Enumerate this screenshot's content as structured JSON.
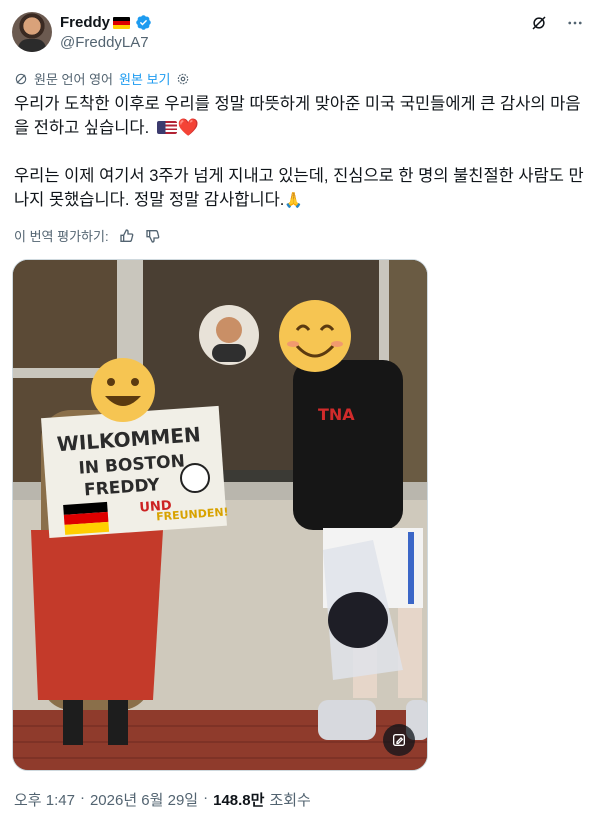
{
  "author": {
    "display_name": "Freddy",
    "handle": "@FreddyLA7",
    "avatar_icon": "profile-photo",
    "verified_icon": "verified-badge-icon"
  },
  "header_actions": {
    "grok_icon": "grok-icon",
    "more_icon": "more-options-icon"
  },
  "translation": {
    "label": "원문 언어 영어",
    "link": "원본 보기",
    "settings_icon": "gear-icon"
  },
  "tweet": {
    "paragraph1": "우리가 도착한 이후로 우리를 정말 따뜻하게 맞아준 미국 국민들에게 큰 감사의 마음을 전하고 싶습니다.",
    "paragraph2": "우리는 이제 여기서 3주가 넘게 지내고 있는데, 진심으로 한 명의 불친절한 사람도 만나지 못했습니다. 정말 정말 감사합니다.",
    "heart_emoji": "❤️",
    "pray_emoji": "🙏"
  },
  "rate_translation": {
    "label": "이 번역 평가하기:",
    "up_icon": "thumbs-up-icon",
    "down_icon": "thumbs-down-icon"
  },
  "photo": {
    "sign_lines": [
      "WILKOMMEN",
      "IN BOSTON",
      "FREDDY",
      "UND",
      "FREUNDEN!"
    ],
    "shirt_text": "TNA",
    "edit_icon": "edit-image-icon"
  },
  "meta": {
    "time": "오후 1:47",
    "separator": "·",
    "date": "2026년 6월 29일",
    "views_count": "148.8만",
    "views_label": "조회수"
  },
  "colors": {
    "link": "#1d9bf0",
    "secondary_text": "#536471",
    "primary_text": "#0f1419",
    "verified": "#1d9bf0"
  }
}
